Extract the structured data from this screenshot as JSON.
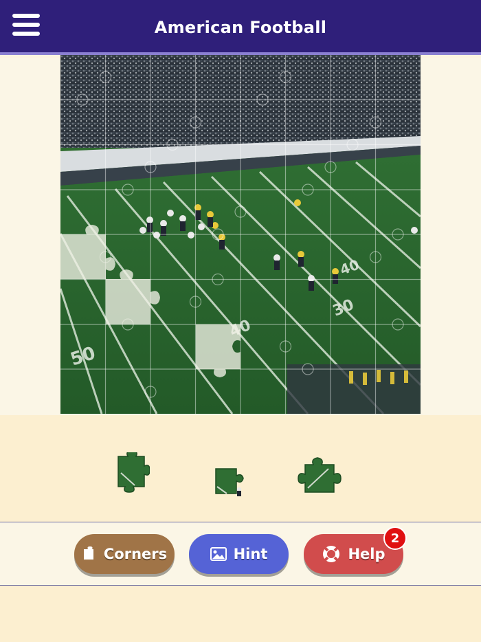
{
  "header": {
    "title": "American Football",
    "menu_icon": "hamburger-menu-icon",
    "colors": {
      "bar": "#2f1f7a",
      "underline": "#8a7fd1"
    }
  },
  "puzzle": {
    "image_subject": "football-stadium-field",
    "grid_columns": 8,
    "grid_rows": 8,
    "missing_pieces": [
      {
        "col": 0,
        "row": 4
      },
      {
        "col": 1,
        "row": 5
      },
      {
        "col": 3,
        "row": 6
      }
    ]
  },
  "tray": {
    "piece_count": 3
  },
  "buttons": {
    "corners": {
      "label": "Corners",
      "icon": "corner-piece-icon",
      "color": "#a07447"
    },
    "hint": {
      "label": "Hint",
      "icon": "image-icon",
      "color": "#5563d6"
    },
    "help": {
      "label": "Help",
      "icon": "lifebuoy-icon",
      "color": "#d14c4c",
      "badge": "2"
    }
  }
}
